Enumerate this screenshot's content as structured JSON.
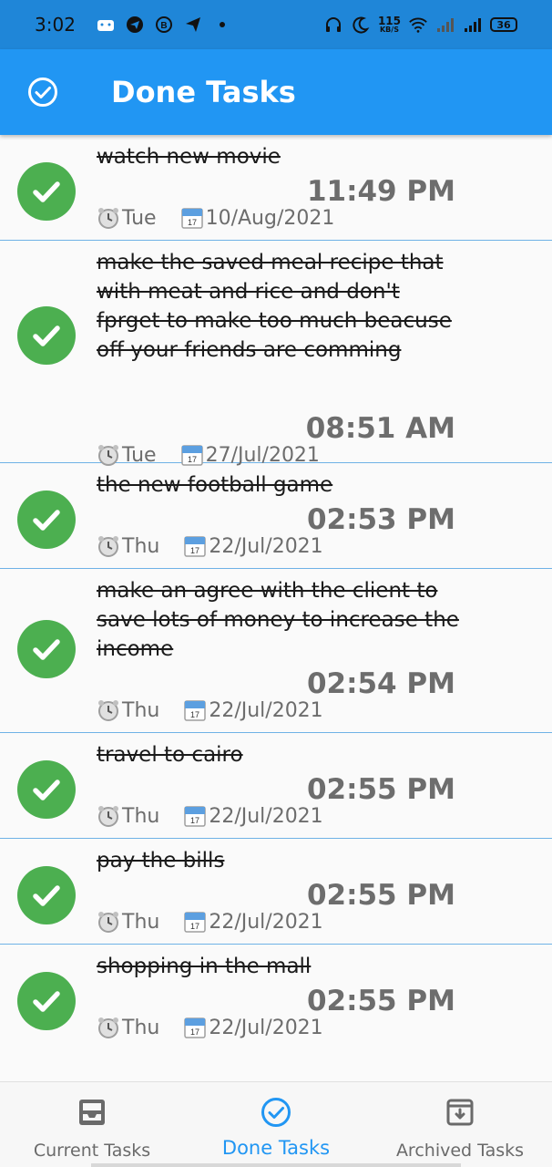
{
  "status_bar": {
    "time": "3:02",
    "net_speed_value": "115",
    "net_speed_unit": "KB/S",
    "battery": "36"
  },
  "app_bar": {
    "title": "Done Tasks"
  },
  "tasks": [
    {
      "title": "watch new movie",
      "time": "11:49 PM",
      "day": "Tue",
      "date": "10/Aug/2021"
    },
    {
      "title": "make the saved meal recipe that with meat and rice and don't fprget to make too much beacuse off your friends are comming",
      "time": "08:51 AM",
      "day": "Tue",
      "date": "27/Jul/2021"
    },
    {
      "title": "the new football game",
      "time": "02:53 PM",
      "day": "Thu",
      "date": "22/Jul/2021"
    },
    {
      "title": "make an agree with the client to save lots of money to increase the income",
      "time": "02:54 PM",
      "day": "Thu",
      "date": "22/Jul/2021"
    },
    {
      "title": "travel to cairo",
      "time": "02:55 PM",
      "day": "Thu",
      "date": "22/Jul/2021"
    },
    {
      "title": "pay the bills",
      "time": "02:55 PM",
      "day": "Thu",
      "date": "22/Jul/2021"
    },
    {
      "title": "shopping in the mall",
      "time": "02:55 PM",
      "day": "Thu",
      "date": "22/Jul/2021"
    }
  ],
  "bottom_nav": {
    "items": [
      {
        "label": "Current Tasks",
        "icon": "inbox-icon",
        "active": false
      },
      {
        "label": "Done Tasks",
        "icon": "check-circle-icon",
        "active": true
      },
      {
        "label": "Archived Tasks",
        "icon": "archive-icon",
        "active": false
      }
    ]
  },
  "colors": {
    "app_bar": "#2196f3",
    "check": "#4caf50",
    "divider": "#6fb2e6",
    "active_nav": "#2196f3"
  }
}
